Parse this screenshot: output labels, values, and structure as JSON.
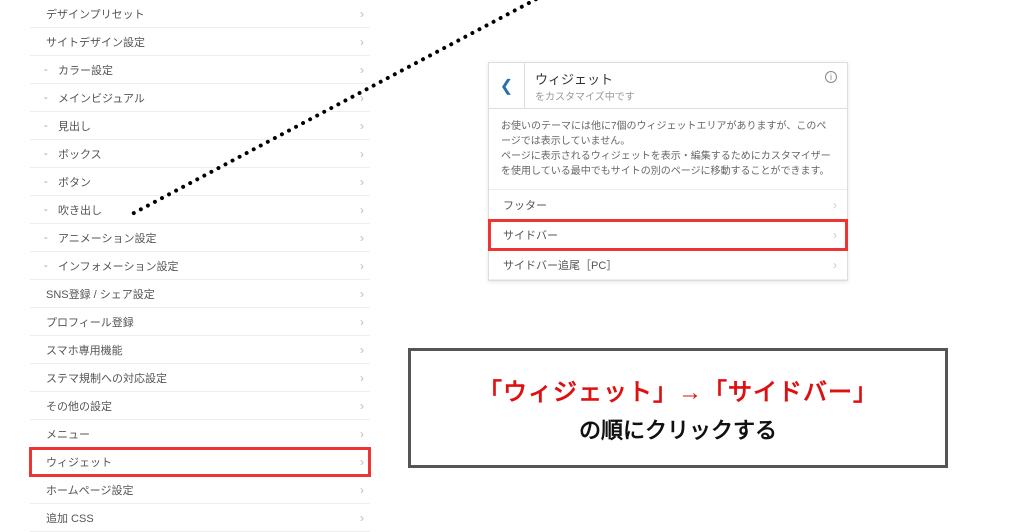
{
  "sidebar": {
    "items": [
      {
        "label": "デザインプリセット",
        "sub": false
      },
      {
        "label": "サイトデザイン設定",
        "sub": false
      },
      {
        "label": "カラー設定",
        "sub": true
      },
      {
        "label": "メインビジュアル",
        "sub": true
      },
      {
        "label": "見出し",
        "sub": true
      },
      {
        "label": "ボックス",
        "sub": true
      },
      {
        "label": "ボタン",
        "sub": true
      },
      {
        "label": "吹き出し",
        "sub": true
      },
      {
        "label": "アニメーション設定",
        "sub": true
      },
      {
        "label": "インフォメーション設定",
        "sub": true
      },
      {
        "label": "SNS登録 / シェア設定",
        "sub": false
      },
      {
        "label": "プロフィール登録",
        "sub": false
      },
      {
        "label": "スマホ専用機能",
        "sub": false
      },
      {
        "label": "ステマ規制への対応設定",
        "sub": false
      },
      {
        "label": "その他の設定",
        "sub": false
      },
      {
        "label": "メニュー",
        "sub": false
      },
      {
        "label": "ウィジェット",
        "sub": false,
        "highlight": true
      },
      {
        "label": "ホームページ設定",
        "sub": false
      },
      {
        "label": "追加 CSS",
        "sub": false
      }
    ]
  },
  "panel": {
    "title": "ウィジェット",
    "subtitle": "をカスタマイズ中です",
    "desc1": "お使いのテーマには他に7個のウィジェットエリアがありますが、このページでは表示していません。",
    "desc2": "ページに表示されるウィジェットを表示・編集するためにカスタマイザーを使用している最中でもサイトの別のページに移動することができます。",
    "rows": [
      {
        "label": "フッター",
        "highlight": false
      },
      {
        "label": "サイドバー",
        "highlight": true
      },
      {
        "label": "サイドバー追尾［PC］",
        "highlight": false
      }
    ]
  },
  "callout": {
    "line1": "「ウィジェット」→「サイドバー」",
    "line2": "の順にクリックする"
  }
}
